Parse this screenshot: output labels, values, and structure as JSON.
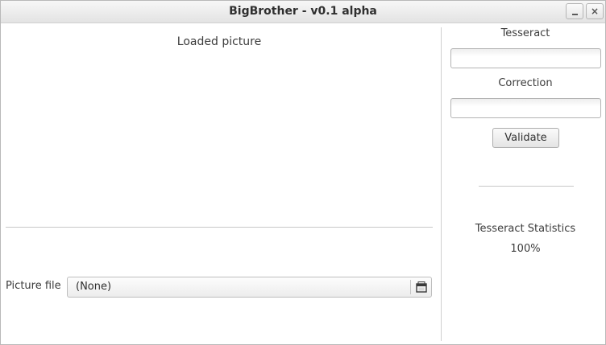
{
  "window": {
    "title": "BigBrother - v0.1 alpha",
    "minimize_glyph": "_",
    "close_glyph": "×"
  },
  "left_panel": {
    "picture_label": "Loaded picture",
    "file_label": "Picture file",
    "file_value": "(None)",
    "file_button_icon": "folder-icon"
  },
  "right_panel": {
    "tesseract_label": "Tesseract",
    "tesseract_value": "",
    "correction_label": "Correction",
    "correction_value": "",
    "validate_label": "Validate",
    "stats_label": "Tesseract Statistics",
    "stats_value": "100%"
  }
}
